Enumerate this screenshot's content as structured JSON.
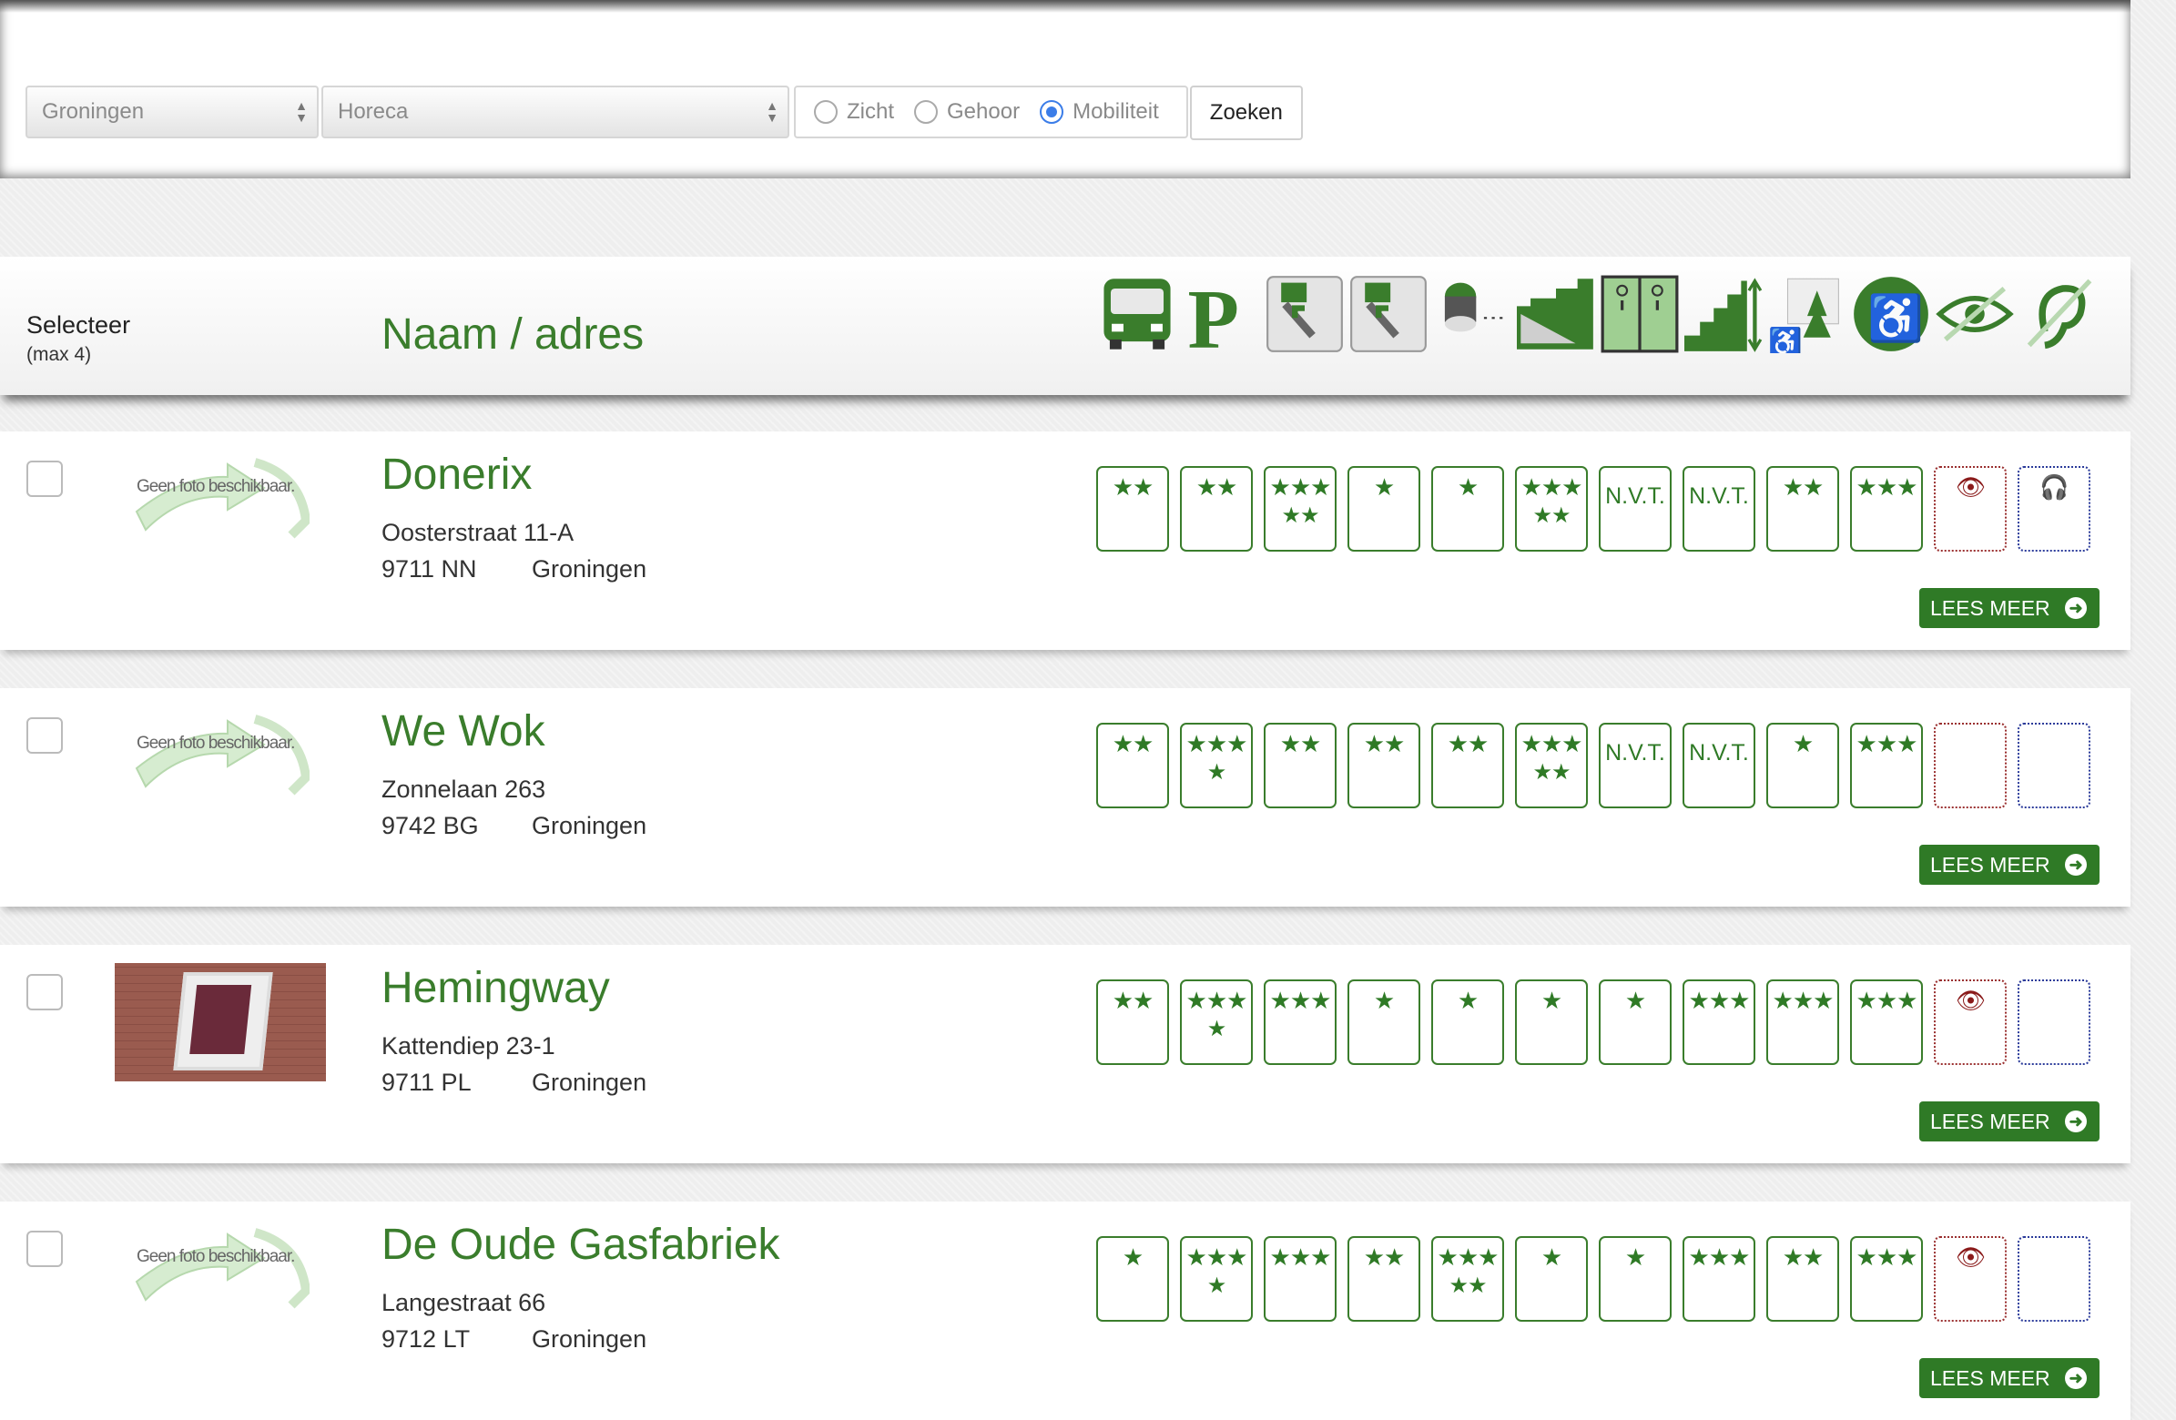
{
  "filters": {
    "city": "Groningen",
    "category": "Horeca",
    "options": [
      {
        "label": "Zicht",
        "checked": false
      },
      {
        "label": "Gehoor",
        "checked": false
      },
      {
        "label": "Mobiliteit",
        "checked": true
      }
    ],
    "search_label": "Zoeken"
  },
  "header": {
    "select_label": "Selecteer",
    "select_sub": "(max 4)",
    "name_label": "Naam / adres",
    "icons": [
      "bus-icon",
      "parking-icon",
      "entrance-left-icon",
      "entrance-right-icon",
      "doorbell-icon",
      "ramp-icon",
      "elevator-icon",
      "stairs-icon",
      "toilet-outdoor-icon",
      "wheelchair-icon",
      "eye-icon",
      "ear-icon"
    ]
  },
  "colors": {
    "accent": "#2f7a26",
    "sight": "#8a1a1a",
    "hearing": "#1e2b7a"
  },
  "placeholder_photo_text": "Geen foto beschikbaar.",
  "read_more": "LEES MEER",
  "venues": [
    {
      "name": "Donerix",
      "street": "Oosterstraat 11-A",
      "postal": "9711 NN",
      "city": "Groningen",
      "has_photo": false,
      "ratings": [
        [
          "★★",
          ""
        ],
        [
          "★★",
          ""
        ],
        [
          "★★★",
          "★★"
        ],
        [
          "★",
          ""
        ],
        [
          "★",
          ""
        ],
        [
          "★★★",
          "★★"
        ],
        [
          "N.V.T.",
          ""
        ],
        [
          "N.V.T.",
          ""
        ],
        [
          "★★",
          ""
        ],
        [
          "★★★",
          ""
        ]
      ],
      "sight": "👁",
      "hearing": "🎧"
    },
    {
      "name": "We Wok",
      "street": "Zonnelaan 263",
      "postal": "9742 BG",
      "city": "Groningen",
      "has_photo": false,
      "ratings": [
        [
          "★★",
          ""
        ],
        [
          "★★★",
          "★"
        ],
        [
          "★★",
          ""
        ],
        [
          "★★",
          ""
        ],
        [
          "★★",
          ""
        ],
        [
          "★★★",
          "★★"
        ],
        [
          "N.V.T.",
          ""
        ],
        [
          "N.V.T.",
          ""
        ],
        [
          "★",
          ""
        ],
        [
          "★★★",
          ""
        ]
      ],
      "sight": "",
      "hearing": ""
    },
    {
      "name": "Hemingway",
      "street": "Kattendiep 23-1",
      "postal": "9711 PL",
      "city": "Groningen",
      "has_photo": true,
      "ratings": [
        [
          "★★",
          ""
        ],
        [
          "★★★",
          "★"
        ],
        [
          "★★★",
          ""
        ],
        [
          "★",
          ""
        ],
        [
          "★",
          ""
        ],
        [
          "★",
          ""
        ],
        [
          "★",
          ""
        ],
        [
          "★★★",
          ""
        ],
        [
          "★★★",
          ""
        ],
        [
          "★★★",
          ""
        ]
      ],
      "sight": "👁",
      "hearing": ""
    },
    {
      "name": "De Oude Gasfabriek",
      "street": "Langestraat 66",
      "postal": "9712 LT",
      "city": "Groningen",
      "has_photo": false,
      "ratings": [
        [
          "★",
          ""
        ],
        [
          "★★★",
          "★"
        ],
        [
          "★★★",
          ""
        ],
        [
          "★★",
          ""
        ],
        [
          "★★★",
          "★★"
        ],
        [
          "★",
          ""
        ],
        [
          "★",
          ""
        ],
        [
          "★★★",
          ""
        ],
        [
          "★★",
          ""
        ],
        [
          "★★★",
          ""
        ]
      ],
      "sight": "👁",
      "hearing": ""
    }
  ]
}
